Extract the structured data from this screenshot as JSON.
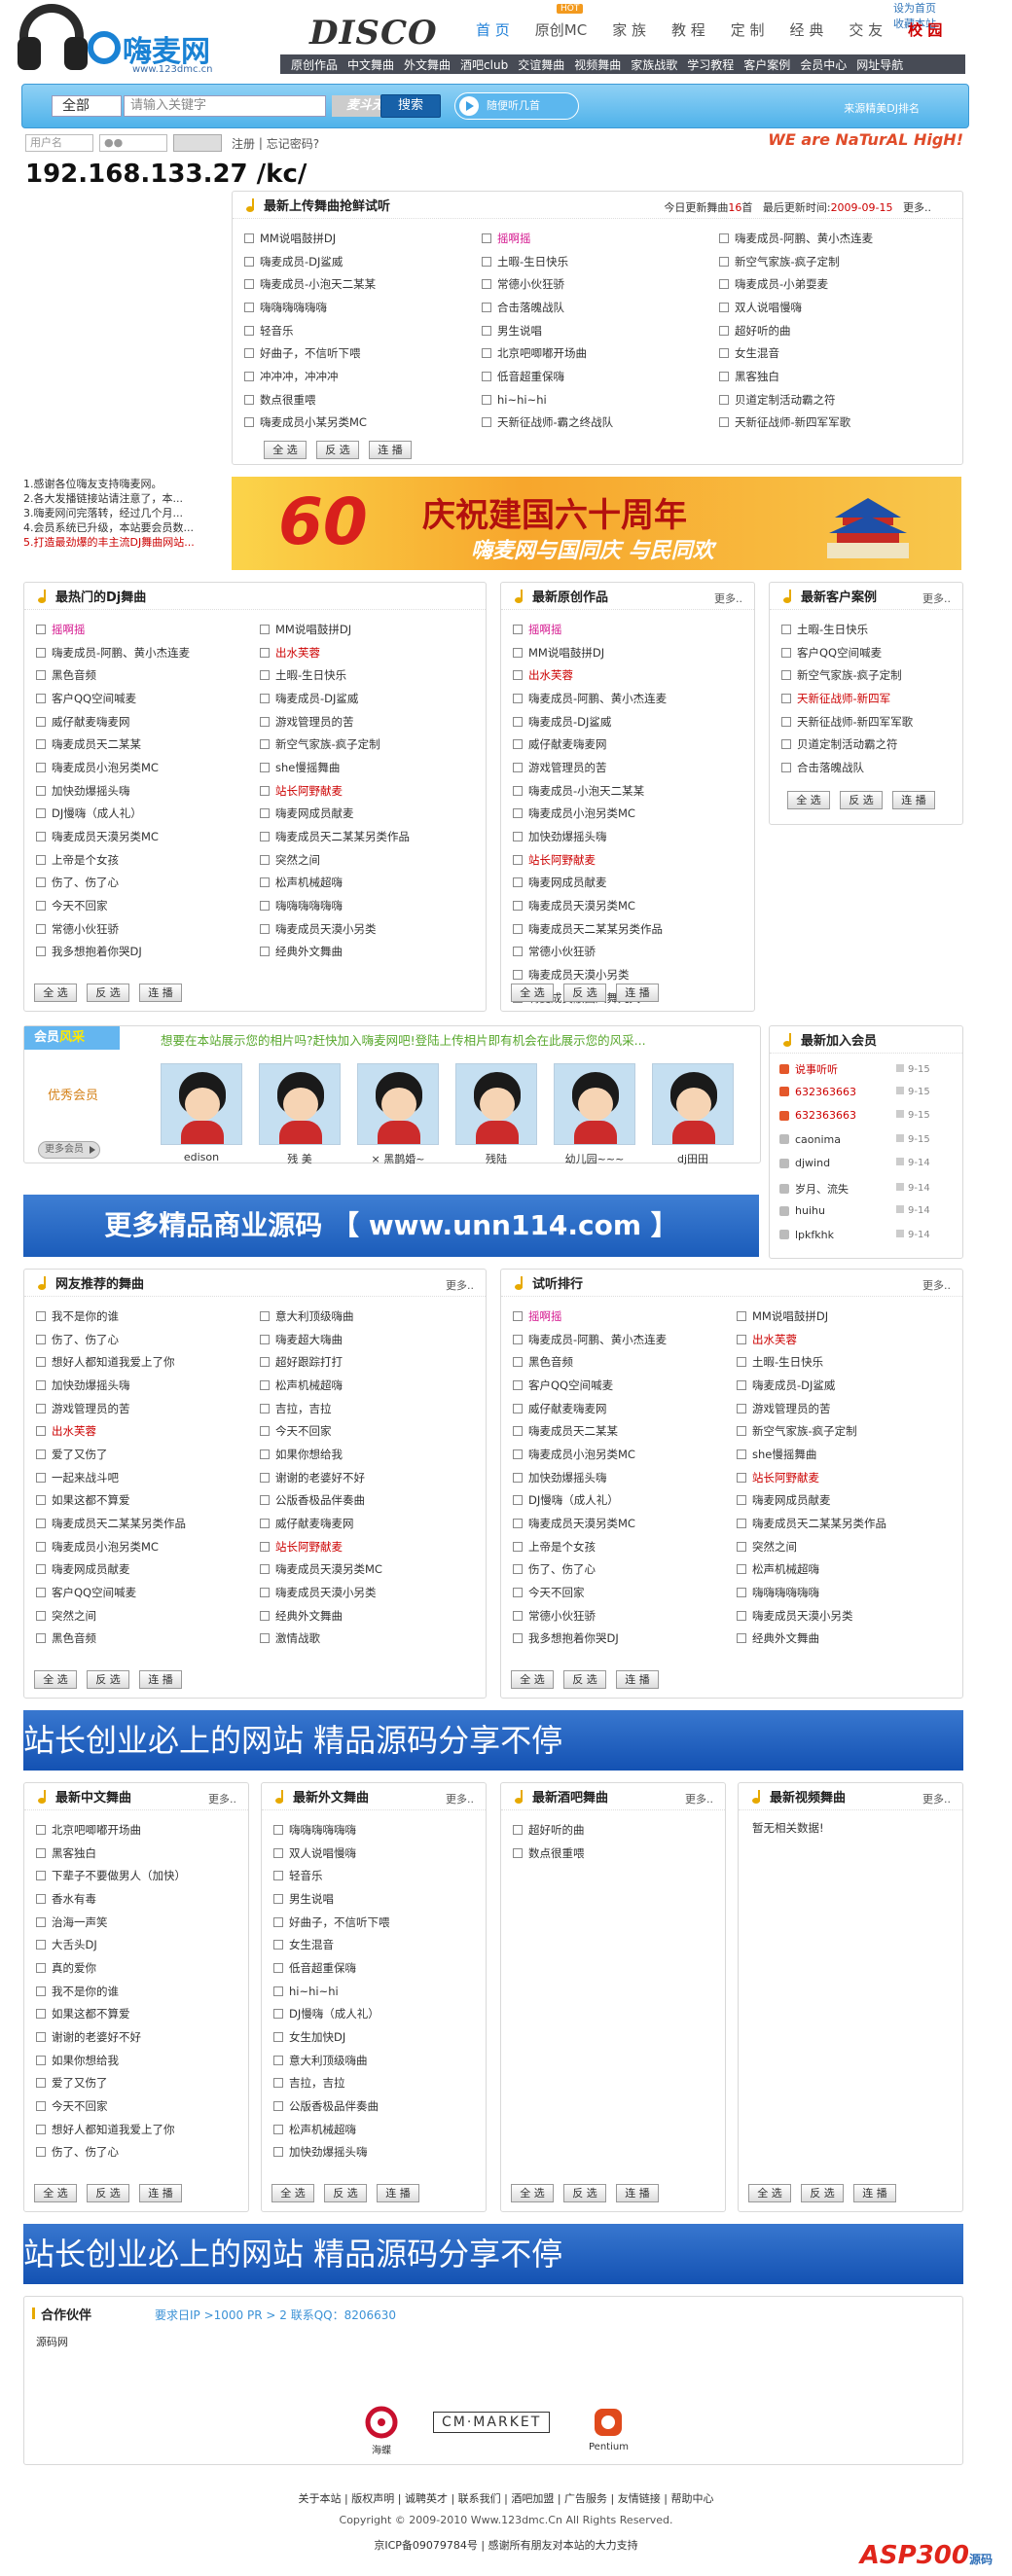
{
  "header": {
    "logo_text": "嗨麦网",
    "logo_url": "www.123dmc.cn",
    "disco": "DISCO",
    "hot": "HOT",
    "set_home": "设为首页",
    "favorite": "收藏本站",
    "top_menu": [
      "首 页",
      "原创MC",
      "家 族",
      "教 程",
      "定 制",
      "经 典",
      "交 友",
      "校 园"
    ],
    "sub_menu": [
      "原创作品",
      "中文舞曲",
      "外文舞曲",
      "酒吧club",
      "交谊舞曲",
      "视频舞曲",
      "家族战歌",
      "学习教程",
      "客户案例",
      "会员中心",
      "网址导航"
    ]
  },
  "search": {
    "select": "全部",
    "placeholder": "请输入关键字",
    "hint": "麦斗无嘉",
    "button": "搜索",
    "play": "随便听几首",
    "welcome": "来源精美DJ排名"
  },
  "login": {
    "user_placeholder": "用户名",
    "pass_placeholder": "●●",
    "register": "注册",
    "forgot": "忘记密码?",
    "slogan": "WE are NaTurAL HigH!"
  },
  "ip_text": "192.168.133.27 /kc/",
  "latest": {
    "title": "最新上传舞曲抢鲜试听",
    "info_prefix": "今日更新舞曲",
    "count": "16",
    "unit": "首",
    "time_label": "最后更新时间:",
    "time": "2009-09-15",
    "more": "更多..",
    "songs": [
      {
        "t": "MM说唱鼓拼DJ",
        "c": ""
      },
      {
        "t": "摇啊摇",
        "c": "pink"
      },
      {
        "t": "嗨麦成员-阿鹏、黄小杰连麦",
        "c": ""
      },
      {
        "t": "嗨麦成员-DJ鲨威",
        "c": ""
      },
      {
        "t": "土暇-生日快乐",
        "c": ""
      },
      {
        "t": "新空气家族-疯子定制",
        "c": ""
      },
      {
        "t": "嗨麦成员-小泡天二某某",
        "c": ""
      },
      {
        "t": "常德小伙狂骄",
        "c": ""
      },
      {
        "t": "嗨麦成员-小弟耍麦",
        "c": ""
      },
      {
        "t": "嗨嗨嗨嗨嗨嗨",
        "c": ""
      },
      {
        "t": "合击落魄战队",
        "c": ""
      },
      {
        "t": "双人说唱慢嗨",
        "c": ""
      },
      {
        "t": "轻音乐",
        "c": ""
      },
      {
        "t": "男生说唱",
        "c": ""
      },
      {
        "t": "超好听的曲",
        "c": ""
      },
      {
        "t": "好曲子，不信听下喂",
        "c": ""
      },
      {
        "t": "北京吧唧嘟开场曲",
        "c": ""
      },
      {
        "t": "女生混音",
        "c": ""
      },
      {
        "t": "冲冲冲，冲冲冲",
        "c": ""
      },
      {
        "t": "低音超重保嗨",
        "c": ""
      },
      {
        "t": "黑客独白",
        "c": ""
      },
      {
        "t": "数点很重喂",
        "c": ""
      },
      {
        "t": "hi~hi~hi",
        "c": ""
      },
      {
        "t": "贝道定制活动霸之符",
        "c": ""
      },
      {
        "t": "嗨麦成员小某另类MC",
        "c": ""
      },
      {
        "t": "天新征战师-霸之终战队",
        "c": ""
      },
      {
        "t": "天新征战师-新四军军歌",
        "c": ""
      }
    ],
    "buttons": [
      "全 选",
      "反 选",
      "连 播"
    ]
  },
  "notices": [
    "1.感谢各位嗨友支持嗨麦网。",
    "2.各大发播链接站请注意了，本...",
    "3.嗨麦网问完落转，经过几个月...",
    "4.会员系统已升级，本站要会员数...",
    "5.打造最劲爆的丰主流DJ舞曲网站..."
  ],
  "banner60": {
    "num": "60",
    "title": "庆祝建国六十周年",
    "sub": "嗨麦网与国同庆 与民同欢"
  },
  "hot": {
    "title": "最热门的Dj舞曲",
    "songs": [
      {
        "t": "摇啊摇",
        "c": "pink"
      },
      {
        "t": "MM说唱鼓拼DJ",
        "c": ""
      },
      {
        "t": "嗨麦成员-阿鹏、黄小杰连麦",
        "c": ""
      },
      {
        "t": "出水芙蓉",
        "c": "red"
      },
      {
        "t": "黑色音频",
        "c": ""
      },
      {
        "t": "土暇-生日快乐",
        "c": ""
      },
      {
        "t": "客户QQ空间喊麦",
        "c": ""
      },
      {
        "t": "嗨麦成员-DJ鲨威",
        "c": ""
      },
      {
        "t": "威仔献麦嗨麦网",
        "c": ""
      },
      {
        "t": "游戏管理员的苦",
        "c": ""
      },
      {
        "t": "嗨麦成员天二某某",
        "c": ""
      },
      {
        "t": "新空气家族-疯子定制",
        "c": ""
      },
      {
        "t": "嗨麦成员小泡另类MC",
        "c": ""
      },
      {
        "t": "she慢摇舞曲",
        "c": ""
      },
      {
        "t": "加快劲爆摇头嗨",
        "c": ""
      },
      {
        "t": "站长阿野献麦",
        "c": "red"
      },
      {
        "t": "DJ慢嗨（成人礼）",
        "c": ""
      },
      {
        "t": "嗨麦网成员献麦",
        "c": ""
      },
      {
        "t": "嗨麦成员天漠另类MC",
        "c": ""
      },
      {
        "t": "嗨麦成员天二某某另类作品",
        "c": ""
      },
      {
        "t": "上帝是个女孩",
        "c": ""
      },
      {
        "t": "突然之间",
        "c": ""
      },
      {
        "t": "伤了、伤了心",
        "c": ""
      },
      {
        "t": "松声机械超嗨",
        "c": ""
      },
      {
        "t": "今天不回家",
        "c": ""
      },
      {
        "t": "嗨嗨嗨嗨嗨嗨",
        "c": ""
      },
      {
        "t": "常德小伙狂骄",
        "c": ""
      },
      {
        "t": "嗨麦成员天漠小另类",
        "c": ""
      },
      {
        "t": "我多想抱着你哭DJ",
        "c": ""
      },
      {
        "t": "经典外文舞曲",
        "c": ""
      }
    ]
  },
  "original": {
    "title": "最新原创作品",
    "more": "更多..",
    "songs": [
      {
        "t": "摇啊摇",
        "c": "pink"
      },
      {
        "t": "MM说唱鼓拼DJ",
        "c": ""
      },
      {
        "t": "出水芙蓉",
        "c": "red"
      },
      {
        "t": "嗨麦成员-阿鹏、黄小杰连麦",
        "c": ""
      },
      {
        "t": "嗨麦成员-DJ鲨威",
        "c": ""
      },
      {
        "t": "威仔献麦嗨麦网",
        "c": ""
      },
      {
        "t": "游戏管理员的苦",
        "c": ""
      },
      {
        "t": "嗨麦成员-小泡天二某某",
        "c": ""
      },
      {
        "t": "嗨麦成员小泡另类MC",
        "c": ""
      },
      {
        "t": "加快劲爆摇头嗨",
        "c": ""
      },
      {
        "t": "站长阿野献麦",
        "c": "red"
      },
      {
        "t": "嗨麦网成员献麦",
        "c": ""
      },
      {
        "t": "嗨麦成员天漠另类MC",
        "c": ""
      },
      {
        "t": "嗨麦成员天二某某另类作品",
        "c": ""
      },
      {
        "t": "常德小伙狂骄",
        "c": ""
      },
      {
        "t": "嗨麦成员天漠小另类",
        "c": ""
      },
      {
        "t": "嗨麦成员献曲凤舞九天",
        "c": ""
      }
    ]
  },
  "cases": {
    "title": "最新客户案例",
    "more": "更多..",
    "songs": [
      {
        "t": "土暇-生日快乐",
        "c": ""
      },
      {
        "t": "客户QQ空间喊麦",
        "c": ""
      },
      {
        "t": "新空气家族-疯子定制",
        "c": ""
      },
      {
        "t": "天新征战师-新四军",
        "c": "red"
      },
      {
        "t": "天新征战师-新四军军歌",
        "c": ""
      },
      {
        "t": "贝道定制活动霸之符",
        "c": ""
      },
      {
        "t": "合击落魄战队",
        "c": ""
      }
    ]
  },
  "members": {
    "tab_a": "会员",
    "tab_b": "风采",
    "text": "想要在本站展示您的相片吗?赶快加入嗨麦网吧!登陆上传相片即有机会在此展示您的风采...",
    "label": "优秀会员",
    "more": "更多会员",
    "list": [
      "edison",
      "残 美",
      "× 黑鹊婚~",
      "残陆",
      "幼儿园~~~",
      "dj田田"
    ]
  },
  "newusers": {
    "title": "最新加入会员",
    "list": [
      {
        "n": "说事听听",
        "d": "9-15",
        "c": "red"
      },
      {
        "n": "632363663",
        "d": "9-15",
        "c": "red"
      },
      {
        "n": "632363663",
        "d": "9-15",
        "c": "red"
      },
      {
        "n": "caonima",
        "d": "9-15",
        "c": ""
      },
      {
        "n": "djwind",
        "d": "9-14",
        "c": ""
      },
      {
        "n": "岁月、流失",
        "d": "9-14",
        "c": ""
      },
      {
        "n": "huihu",
        "d": "9-14",
        "c": ""
      },
      {
        "n": "lpkfkhk",
        "d": "9-14",
        "c": ""
      }
    ]
  },
  "unn": "更多精品商业源码 【 www.unn114.com 】",
  "recommend": {
    "title": "网友推荐的舞曲",
    "more": "更多..",
    "songs": [
      {
        "t": "我不是你的谁",
        "c": ""
      },
      {
        "t": "意大利顶级嗨曲",
        "c": ""
      },
      {
        "t": "伤了、伤了心",
        "c": ""
      },
      {
        "t": "嗨麦超大嗨曲",
        "c": ""
      },
      {
        "t": "想好人都知道我爱上了你",
        "c": ""
      },
      {
        "t": "超好跟踪打打",
        "c": ""
      },
      {
        "t": "加快劲爆摇头嗨",
        "c": ""
      },
      {
        "t": "松声机械超嗨",
        "c": ""
      },
      {
        "t": "游戏管理员的苦",
        "c": ""
      },
      {
        "t": "吉拉，吉拉",
        "c": ""
      },
      {
        "t": "出水芙蓉",
        "c": "red"
      },
      {
        "t": "今天不回家",
        "c": ""
      },
      {
        "t": "爱了又伤了",
        "c": ""
      },
      {
        "t": "如果你想给我",
        "c": ""
      },
      {
        "t": "一起来战斗吧",
        "c": ""
      },
      {
        "t": "谢谢的老婆好不好",
        "c": ""
      },
      {
        "t": "如果这都不算爱",
        "c": ""
      },
      {
        "t": "公版香极品伴奏曲",
        "c": ""
      },
      {
        "t": "嗨麦成员天二某某另类作品",
        "c": ""
      },
      {
        "t": "威仔献麦嗨麦网",
        "c": ""
      },
      {
        "t": "嗨麦成员小泡另类MC",
        "c": ""
      },
      {
        "t": "站长阿野献麦",
        "c": "red"
      },
      {
        "t": "嗨麦网成员献麦",
        "c": ""
      },
      {
        "t": "嗨麦成员天漠另类MC",
        "c": ""
      },
      {
        "t": "客户QQ空间喊麦",
        "c": ""
      },
      {
        "t": "嗨麦成员天漠小另类",
        "c": ""
      },
      {
        "t": "突然之间",
        "c": ""
      },
      {
        "t": "经典外文舞曲",
        "c": ""
      },
      {
        "t": "黑色音频",
        "c": ""
      },
      {
        "t": "激情战歌",
        "c": ""
      }
    ]
  },
  "ranking": {
    "title": "试听排行",
    "more": "更多..",
    "songs": [
      {
        "t": "摇啊摇",
        "c": "pink"
      },
      {
        "t": "MM说唱鼓拼DJ",
        "c": ""
      },
      {
        "t": "嗨麦成员-阿鹏、黄小杰连麦",
        "c": ""
      },
      {
        "t": "出水芙蓉",
        "c": "red"
      },
      {
        "t": "黑色音频",
        "c": ""
      },
      {
        "t": "土暇-生日快乐",
        "c": ""
      },
      {
        "t": "客户QQ空间喊麦",
        "c": ""
      },
      {
        "t": "嗨麦成员-DJ鲨威",
        "c": ""
      },
      {
        "t": "威仔献麦嗨麦网",
        "c": ""
      },
      {
        "t": "游戏管理员的苦",
        "c": ""
      },
      {
        "t": "嗨麦成员天二某某",
        "c": ""
      },
      {
        "t": "新空气家族-疯子定制",
        "c": ""
      },
      {
        "t": "嗨麦成员小泡另类MC",
        "c": ""
      },
      {
        "t": "she慢摇舞曲",
        "c": ""
      },
      {
        "t": "加快劲爆摇头嗨",
        "c": ""
      },
      {
        "t": "站长阿野献麦",
        "c": "red"
      },
      {
        "t": "DJ慢嗨（成人礼）",
        "c": ""
      },
      {
        "t": "嗨麦网成员献麦",
        "c": ""
      },
      {
        "t": "嗨麦成员天漠另类MC",
        "c": ""
      },
      {
        "t": "嗨麦成员天二某某另类作品",
        "c": ""
      },
      {
        "t": "上帝是个女孩",
        "c": ""
      },
      {
        "t": "突然之间",
        "c": ""
      },
      {
        "t": "伤了、伤了心",
        "c": ""
      },
      {
        "t": "松声机械超嗨",
        "c": ""
      },
      {
        "t": "今天不回家",
        "c": ""
      },
      {
        "t": "嗨嗨嗨嗨嗨嗨",
        "c": ""
      },
      {
        "t": "常德小伙狂骄",
        "c": ""
      },
      {
        "t": "嗨麦成员天漠小另类",
        "c": ""
      },
      {
        "t": "我多想抱着你哭DJ",
        "c": ""
      },
      {
        "t": "经典外文舞曲",
        "c": ""
      }
    ]
  },
  "banner_slogan": "站长创业必上的网站  精品源码分享不停",
  "chinese": {
    "title": "最新中文舞曲",
    "more": "更多..",
    "songs": [
      {
        "t": "北京吧唧嘟开场曲",
        "c": ""
      },
      {
        "t": "黑客独白",
        "c": ""
      },
      {
        "t": "下辈子不要做男人（加快）",
        "c": ""
      },
      {
        "t": "香水有毒",
        "c": ""
      },
      {
        "t": "治海一声笑",
        "c": ""
      },
      {
        "t": "大舌头DJ",
        "c": ""
      },
      {
        "t": "真的爱你",
        "c": ""
      },
      {
        "t": "我不是你的谁",
        "c": ""
      },
      {
        "t": "如果这都不算爱",
        "c": ""
      },
      {
        "t": "谢谢的老婆好不好",
        "c": ""
      },
      {
        "t": "如果你想给我",
        "c": ""
      },
      {
        "t": "爱了又伤了",
        "c": ""
      },
      {
        "t": "今天不回家",
        "c": ""
      },
      {
        "t": "想好人都知道我爱上了你",
        "c": ""
      },
      {
        "t": "伤了、伤了心",
        "c": ""
      }
    ]
  },
  "foreign": {
    "title": "最新外文舞曲",
    "more": "更多..",
    "songs": [
      {
        "t": "嗨嗨嗨嗨嗨嗨",
        "c": ""
      },
      {
        "t": "双人说唱慢嗨",
        "c": ""
      },
      {
        "t": "轻音乐",
        "c": ""
      },
      {
        "t": "男生说唱",
        "c": ""
      },
      {
        "t": "好曲子，不信听下喂",
        "c": ""
      },
      {
        "t": "女生混音",
        "c": ""
      },
      {
        "t": "低音超重保嗨",
        "c": ""
      },
      {
        "t": "hi~hi~hi",
        "c": ""
      },
      {
        "t": "DJ慢嗨（成人礼）",
        "c": ""
      },
      {
        "t": "女生加快DJ",
        "c": ""
      },
      {
        "t": "意大利顶级嗨曲",
        "c": ""
      },
      {
        "t": "吉拉，吉拉",
        "c": ""
      },
      {
        "t": "公版香极品伴奏曲",
        "c": ""
      },
      {
        "t": "松声机械超嗨",
        "c": ""
      },
      {
        "t": "加快劲爆摇头嗨",
        "c": ""
      }
    ]
  },
  "bar": {
    "title": "最新酒吧舞曲",
    "more": "更多..",
    "songs": [
      {
        "t": "超好听的曲",
        "c": ""
      },
      {
        "t": "数点很重喂",
        "c": ""
      }
    ]
  },
  "video": {
    "title": "最新视频舞曲",
    "more": "更多..",
    "empty": "暂无相关数据!"
  },
  "partners": {
    "title": "合作伙伴",
    "text": "要求日IP >1000 PR > 2 联系QQ：8206630",
    "row": "源码网",
    "logos": [
      "海蝶",
      "CM·MARKET",
      "Pentium"
    ]
  },
  "footer": {
    "links": "关于本站 | 版权声明 | 诚聘英才 | 联系我们 | 酒吧加盟 | 广告服务 | 友情链接 | 帮助中心",
    "copyright": "Copyright © 2009-2010 Www.123dmc.Cn All Rights Reserved.",
    "icp": "京ICP备09079784号 | 感谢所有朋友对本站的大力支持",
    "brand": "ASP300",
    "brand_sub": "源码"
  }
}
